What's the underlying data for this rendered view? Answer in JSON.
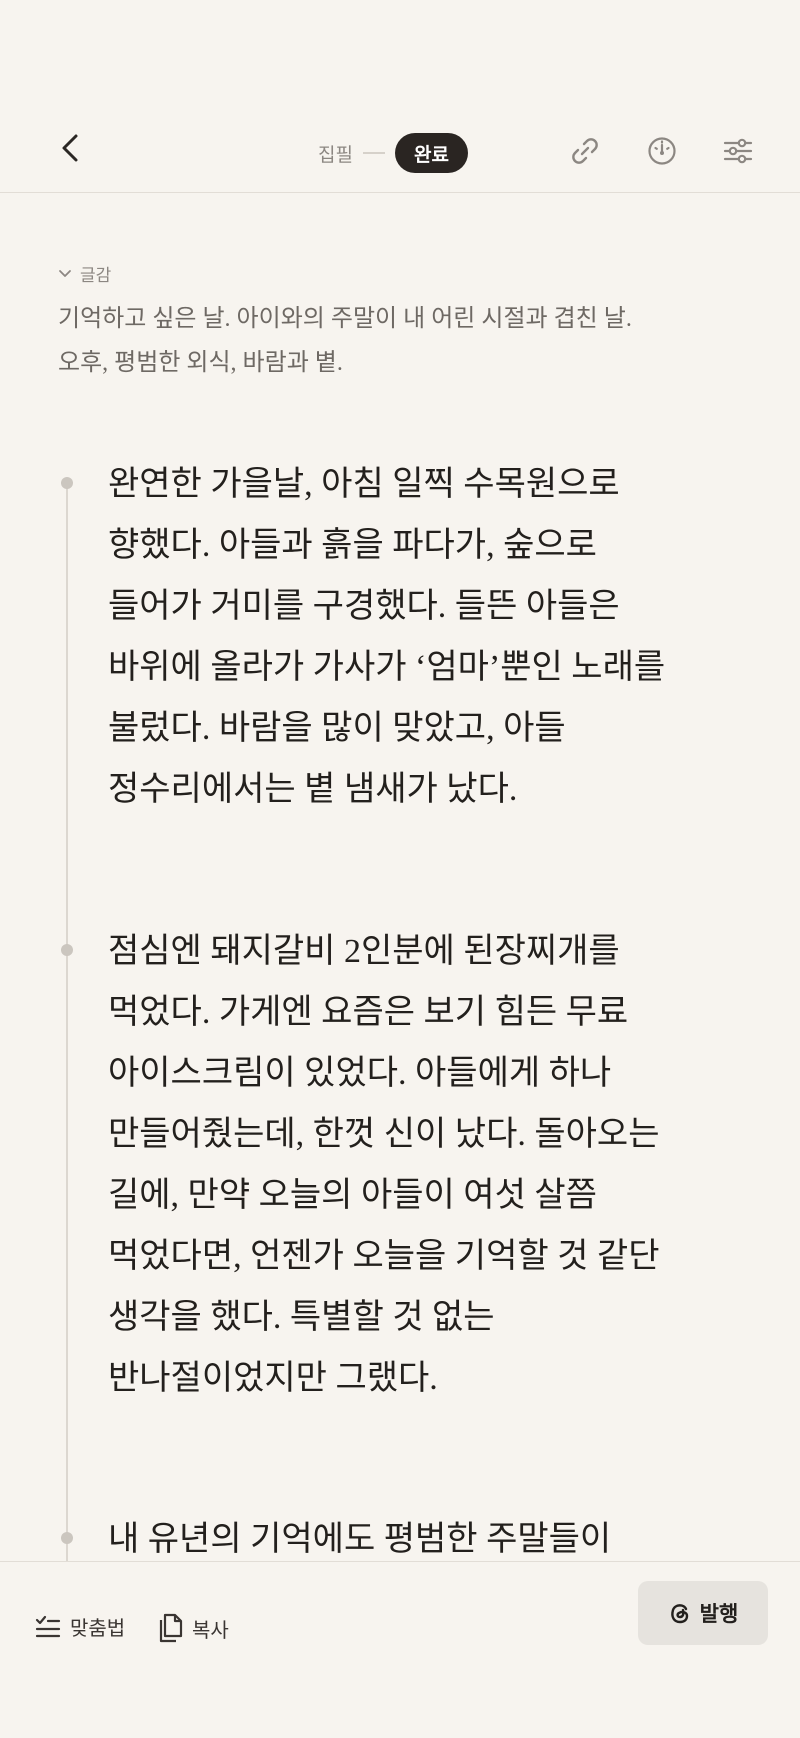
{
  "header": {
    "status_draft": "집필",
    "status_done": "완료"
  },
  "icons": {
    "back": "chevron-left-icon",
    "link": "link-icon",
    "stats": "gauge-icon",
    "settings": "sliders-icon"
  },
  "note": {
    "toggle_label": "글감",
    "text_lines": [
      "기억하고 싶은 날. 아이와의 주말이 내 어린 시절과 겹친 날.",
      "오후, 평범한 외식, 바람과 볕."
    ]
  },
  "entries": [
    {
      "lines": [
        "완연한 가을날, 아침 일찍 수목원으로",
        "향했다. 아들과 흙을 파다가, 숲으로",
        "들어가 거미를 구경했다. 들뜬 아들은",
        "바위에 올라가 가사가 ‘엄마’뿐인 노래를",
        "불렀다. 바람을 많이 맞았고, 아들",
        "정수리에서는 볕 냄새가 났다."
      ]
    },
    {
      "lines": [
        "점심엔 돼지갈비 2인분에 된장찌개를",
        "먹었다. 가게엔 요즘은 보기 힘든 무료",
        "아이스크림이 있었다. 아들에게 하나",
        "만들어줬는데, 한껏 신이 났다. 돌아오는",
        "길에, 만약 오늘의 아들이 여섯 살쯤",
        "먹었다면, 언젠가 오늘을 기억할 것 같단",
        "생각을 했다. 특별할 것 없는",
        "반나절이었지만 그랬다."
      ]
    },
    {
      "lines": [
        "내 유년의 기억에도 평범한 주말들이"
      ]
    }
  ],
  "bottom_bar": {
    "spellcheck_label": "맞춤법",
    "copy_label": "복사",
    "publish_label": "발행"
  }
}
